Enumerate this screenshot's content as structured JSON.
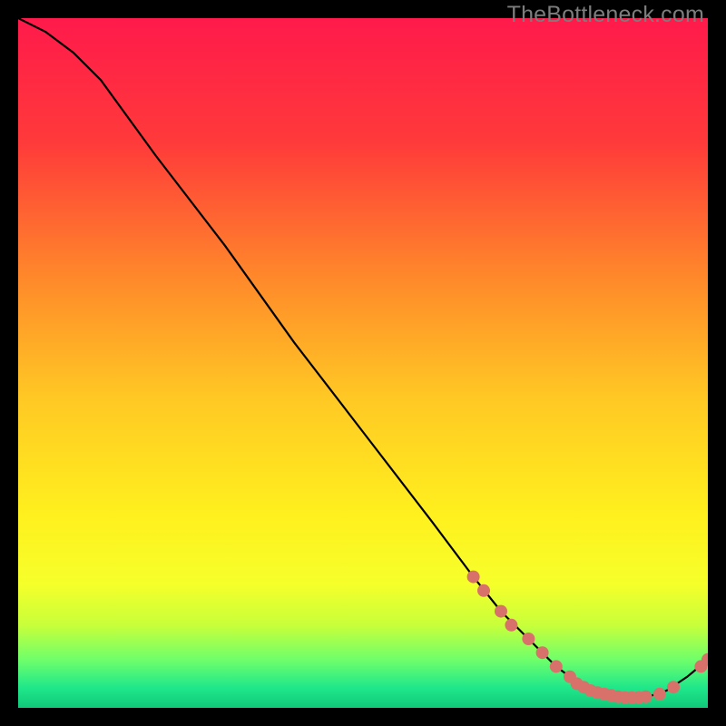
{
  "watermark": "TheBottleneck.com",
  "chart_data": {
    "type": "line",
    "title": "",
    "xlabel": "",
    "ylabel": "",
    "xlim": [
      0,
      100
    ],
    "ylim": [
      0,
      100
    ],
    "series": [
      {
        "name": "curve",
        "x": [
          0,
          4,
          8,
          12,
          20,
          30,
          40,
          50,
          60,
          66,
          70,
          74,
          78,
          82,
          85,
          88,
          91,
          94,
          97,
          100
        ],
        "y": [
          100,
          98,
          95,
          91,
          80,
          67,
          53,
          40,
          27,
          19,
          14,
          10,
          6,
          3,
          2,
          1.5,
          1.5,
          2.5,
          4.5,
          7
        ]
      }
    ],
    "markers": {
      "name": "dots",
      "color": "#d9716b",
      "points": [
        {
          "x": 66,
          "y": 19
        },
        {
          "x": 67.5,
          "y": 17
        },
        {
          "x": 70,
          "y": 14
        },
        {
          "x": 71.5,
          "y": 12
        },
        {
          "x": 74,
          "y": 10
        },
        {
          "x": 76,
          "y": 8
        },
        {
          "x": 78,
          "y": 6
        },
        {
          "x": 80,
          "y": 4.5
        },
        {
          "x": 81,
          "y": 3.5
        },
        {
          "x": 82,
          "y": 3
        },
        {
          "x": 83,
          "y": 2.5
        },
        {
          "x": 84,
          "y": 2.2
        },
        {
          "x": 85,
          "y": 2
        },
        {
          "x": 86,
          "y": 1.8
        },
        {
          "x": 87,
          "y": 1.6
        },
        {
          "x": 88,
          "y": 1.5
        },
        {
          "x": 89,
          "y": 1.5
        },
        {
          "x": 90,
          "y": 1.5
        },
        {
          "x": 91,
          "y": 1.6
        },
        {
          "x": 93,
          "y": 2.0
        },
        {
          "x": 95,
          "y": 3.0
        },
        {
          "x": 99,
          "y": 6.0
        },
        {
          "x": 100,
          "y": 7.0
        }
      ]
    },
    "gradient_stops": [
      {
        "offset": 0.0,
        "color": "#ff1a4b"
      },
      {
        "offset": 0.18,
        "color": "#ff3a3a"
      },
      {
        "offset": 0.38,
        "color": "#ff8a2a"
      },
      {
        "offset": 0.55,
        "color": "#ffc824"
      },
      {
        "offset": 0.72,
        "color": "#fff01e"
      },
      {
        "offset": 0.82,
        "color": "#f6ff2a"
      },
      {
        "offset": 0.88,
        "color": "#c8ff3a"
      },
      {
        "offset": 0.93,
        "color": "#6fff6a"
      },
      {
        "offset": 0.97,
        "color": "#20e88a"
      },
      {
        "offset": 1.0,
        "color": "#10c97a"
      }
    ]
  }
}
